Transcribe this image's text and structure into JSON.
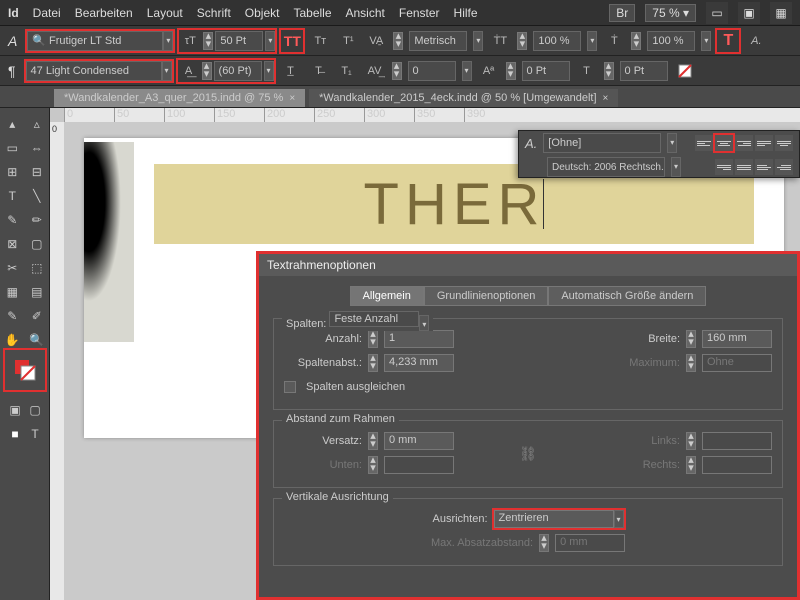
{
  "menu": {
    "items": [
      "Datei",
      "Bearbeiten",
      "Layout",
      "Schrift",
      "Objekt",
      "Tabelle",
      "Ansicht",
      "Fenster",
      "Hilfe"
    ],
    "br": "Br",
    "zoom": "75 %"
  },
  "control": {
    "font": "Frutiger LT Std",
    "style": "47 Light Condensed",
    "size": "50 Pt",
    "leading": "(60 Pt)",
    "kerning": "Metrisch",
    "tracking": "0",
    "vscale": "100 %",
    "hscale": "100 %",
    "baseline": "0 Pt",
    "skew": "0 Pt"
  },
  "tabs": [
    {
      "label": "*Wandkalender_A3_quer_2015.indd @ 75 %",
      "active": true
    },
    {
      "label": "*Wandkalender_2015_4eck.indd @ 50 % [Umgewandelt]",
      "active": false
    }
  ],
  "ruler": [
    "0",
    "50",
    "100",
    "150",
    "200",
    "250",
    "300",
    "350",
    "390"
  ],
  "text_on_page": "THER",
  "para": {
    "style": "[Ohne]",
    "lang": "Deutsch: 2006 Rechtsch..."
  },
  "dialog": {
    "title": "Textrahmenoptionen",
    "tabs": [
      "Allgemein",
      "Grundlinienoptionen",
      "Automatisch Größe ändern"
    ],
    "spalten": {
      "legend": "Spalten:",
      "mode": "Feste Anzahl",
      "anzahl_label": "Anzahl:",
      "anzahl": "1",
      "abst_label": "Spaltenabst.:",
      "abst": "4,233 mm",
      "breite_label": "Breite:",
      "breite": "160 mm",
      "max_label": "Maximum:",
      "max": "Ohne",
      "ausgleichen": "Spalten ausgleichen"
    },
    "abstand": {
      "legend": "Abstand zum Rahmen",
      "versatz": "Versatz:",
      "versatz_v": "0 mm",
      "unten": "Unten:",
      "links": "Links:",
      "rechts": "Rechts:"
    },
    "vert": {
      "legend": "Vertikale Ausrichtung",
      "ausrichten": "Ausrichten:",
      "value": "Zentrieren",
      "maxabs": "Max. Absatzabstand:",
      "maxabs_v": "0 mm"
    }
  }
}
